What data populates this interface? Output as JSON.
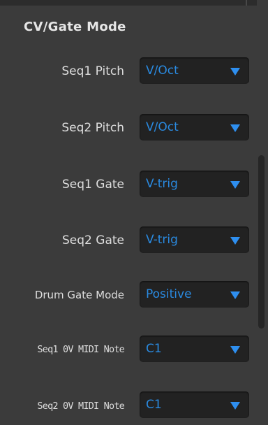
{
  "section": {
    "title": "CV/Gate Mode"
  },
  "rows": [
    {
      "label": "Seq1 Pitch",
      "value": "V/Oct"
    },
    {
      "label": "Seq2 Pitch",
      "value": "V/Oct"
    },
    {
      "label": "Seq1 Gate",
      "value": "V-trig"
    },
    {
      "label": "Seq2 Gate",
      "value": "V-trig"
    },
    {
      "label": "Drum Gate Mode",
      "value": "Positive"
    },
    {
      "label": "Seq1 0V MIDI Note",
      "value": "C1"
    },
    {
      "label": "Seq2 0V MIDI Note",
      "value": "C1"
    }
  ],
  "icons": {
    "dropdown_arrow": "chevron-down-icon"
  },
  "colors": {
    "background": "#3b3b3b",
    "dropdown_bg": "#222222",
    "accent_blue": "#2a8ae0",
    "label_text": "#dedede",
    "title_text": "#e6e6e6"
  }
}
